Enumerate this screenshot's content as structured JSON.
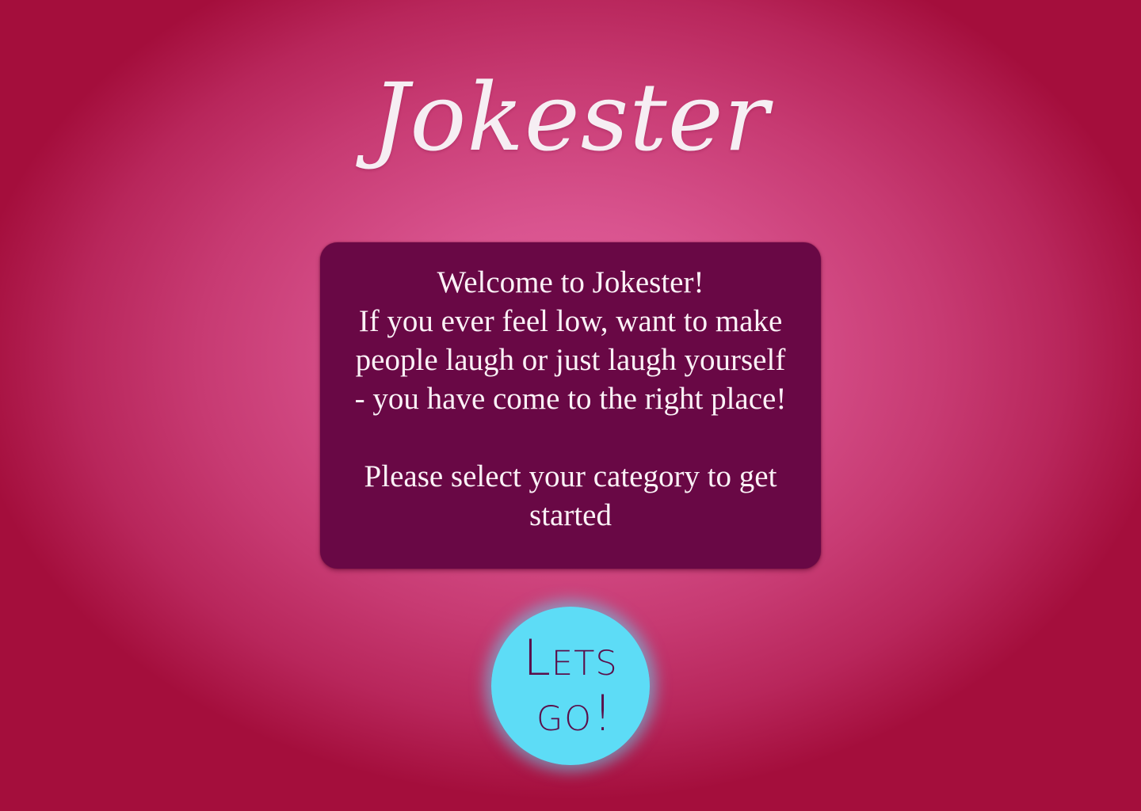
{
  "app": {
    "logo_text": "Jokester"
  },
  "welcome": {
    "line1": "Welcome to Jokester!",
    "line2": "If you ever feel low, want to make",
    "line3": "people laugh or just laugh yourself",
    "line4": "- you have come to the right place!",
    "line5": "Please select your category to get",
    "line6": "started"
  },
  "cta": {
    "line1": "Lets",
    "line2": "go!"
  },
  "colors": {
    "background_center": "#e2619f",
    "background_edge": "#a40e3c",
    "card": "#690845",
    "button": "#5ddcf6",
    "button_text": "#5a0f4a",
    "text_light": "#fbf1f6"
  }
}
